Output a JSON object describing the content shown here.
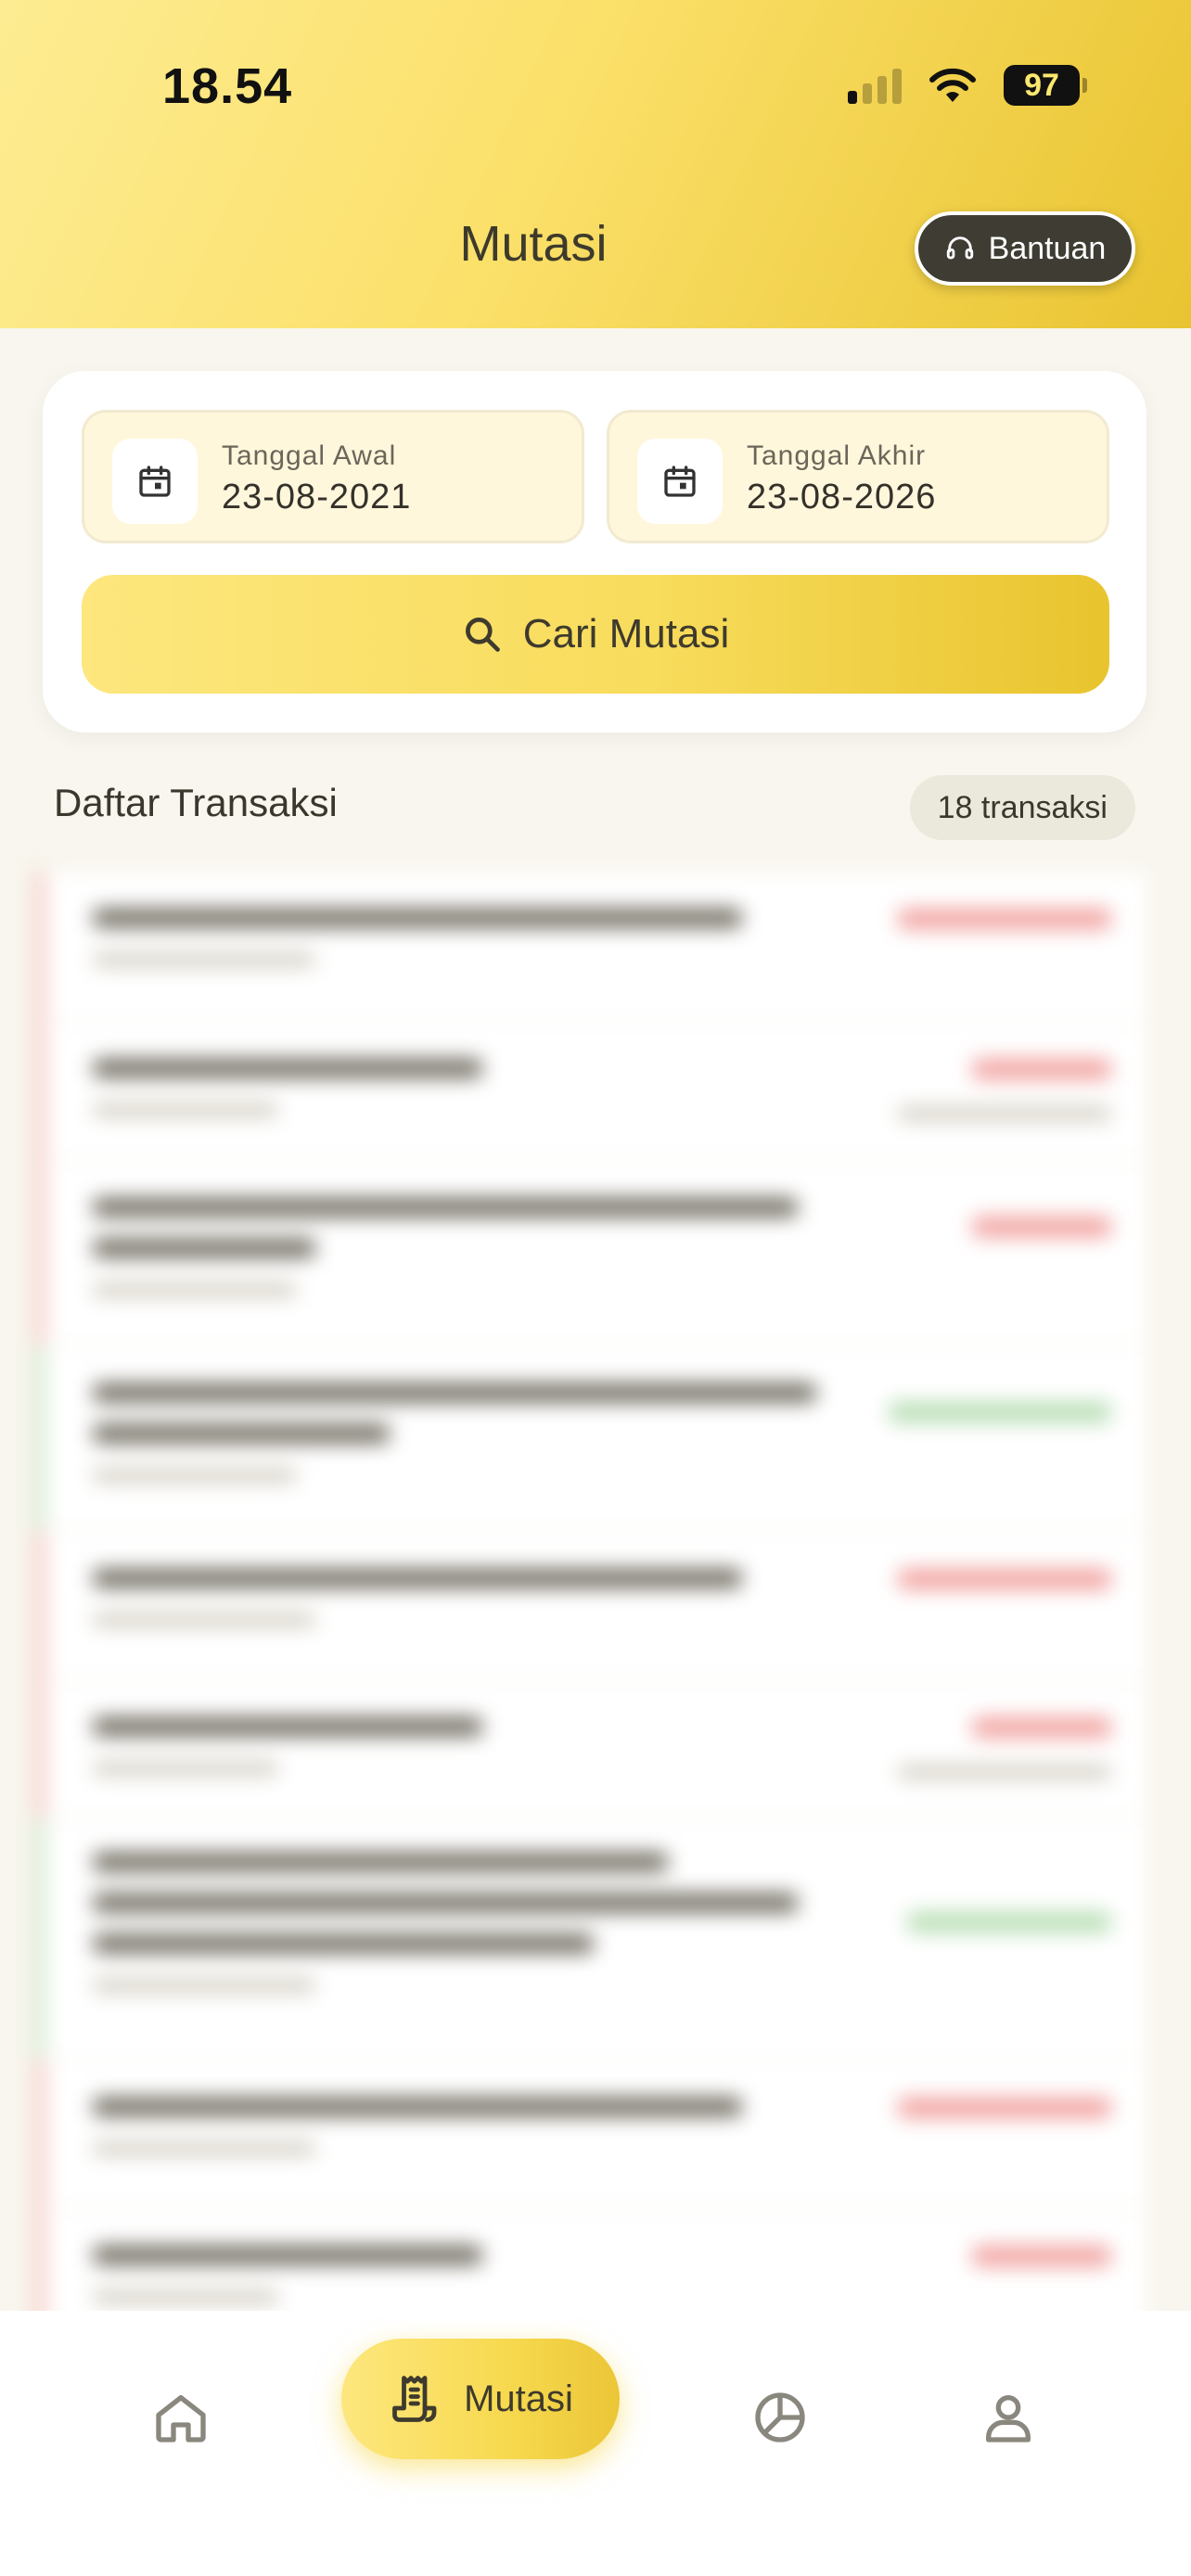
{
  "status_bar": {
    "time": "18.54",
    "battery": "97"
  },
  "header": {
    "title": "Mutasi",
    "help_label": "Bantuan"
  },
  "filter": {
    "start_label": "Tanggal Awal",
    "start_value": "23-08-2021",
    "end_label": "Tanggal Akhir",
    "end_value": "23-08-2026",
    "search_label": "Cari Mutasi"
  },
  "list": {
    "title": "Daftar Transaksi",
    "count": "18 transaksi"
  },
  "bottom_nav": {
    "active_label": "Mutasi"
  },
  "colors": {
    "accent": "#F8DC5C",
    "debit": "#F1A2A0",
    "credit": "#B7DEB4",
    "dark": "#3F3D33"
  }
}
